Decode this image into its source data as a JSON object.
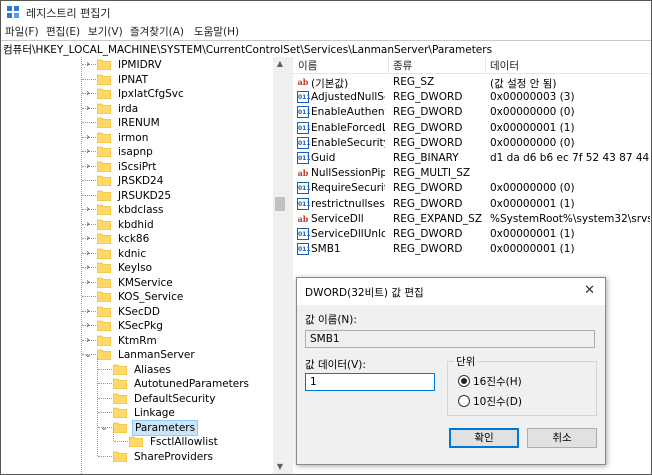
{
  "window": {
    "title": "레지스트리 편집기"
  },
  "menu": [
    "파일(F)",
    "편집(E)",
    "보기(V)",
    "즐겨찾기(A)",
    "도움말(H)"
  ],
  "address": "컴퓨터\\HKEY_LOCAL_MACHINE\\SYSTEM\\CurrentControlSet\\Services\\LanmanServer\\Parameters",
  "tree": {
    "items": [
      {
        "label": "IPMIDRV",
        "chevron": "›"
      },
      {
        "label": "IPNAT",
        "chevron": ""
      },
      {
        "label": "IpxlatCfgSvc",
        "chevron": "›"
      },
      {
        "label": "irda",
        "chevron": "›"
      },
      {
        "label": "IRENUM",
        "chevron": ""
      },
      {
        "label": "irmon",
        "chevron": "›"
      },
      {
        "label": "isapnp",
        "chevron": "›"
      },
      {
        "label": "iScsiPrt",
        "chevron": "›"
      },
      {
        "label": "JRSKD24",
        "chevron": ""
      },
      {
        "label": "JRSUKD25",
        "chevron": ""
      },
      {
        "label": "kbdclass",
        "chevron": "›"
      },
      {
        "label": "kbdhid",
        "chevron": "›"
      },
      {
        "label": "kck86",
        "chevron": "›"
      },
      {
        "label": "kdnic",
        "chevron": "›"
      },
      {
        "label": "KeyIso",
        "chevron": "›"
      },
      {
        "label": "KMService",
        "chevron": "›"
      },
      {
        "label": "KOS_Service",
        "chevron": ""
      },
      {
        "label": "KSecDD",
        "chevron": "›"
      },
      {
        "label": "KSecPkg",
        "chevron": "›"
      },
      {
        "label": "KtmRm",
        "chevron": "›"
      },
      {
        "label": "LanmanServer",
        "chevron": "⌄"
      }
    ],
    "children": [
      {
        "label": "Aliases",
        "chevron": ""
      },
      {
        "label": "AutotunedParameters",
        "chevron": ""
      },
      {
        "label": "DefaultSecurity",
        "chevron": ""
      },
      {
        "label": "Linkage",
        "chevron": ""
      },
      {
        "label": "Parameters",
        "chevron": "⌄",
        "selected": true
      },
      {
        "label": "FsctlAllowlist",
        "chevron": "",
        "level": 2
      },
      {
        "label": "ShareProviders",
        "chevron": ""
      }
    ]
  },
  "list": {
    "columns": [
      "이름",
      "종류",
      "데이터"
    ],
    "rows": [
      {
        "icon": "ab",
        "name": "(기본값)",
        "type": "REG_SZ",
        "data": "(값 설정 안 됨)"
      },
      {
        "icon": "bin",
        "name": "AdjustedNullSes...",
        "type": "REG_DWORD",
        "data": "0x00000003 (3)"
      },
      {
        "icon": "bin",
        "name": "EnableAuthentic...",
        "type": "REG_DWORD",
        "data": "0x00000000 (0)"
      },
      {
        "icon": "bin",
        "name": "EnableForcedLo...",
        "type": "REG_DWORD",
        "data": "0x00000001 (1)"
      },
      {
        "icon": "bin",
        "name": "EnableSecurityS...",
        "type": "REG_DWORD",
        "data": "0x00000000 (0)"
      },
      {
        "icon": "bin",
        "name": "Guid",
        "type": "REG_BINARY",
        "data": "d1 da d6 b6 ec 7f 52 43 87 44 e4 a4"
      },
      {
        "icon": "ab",
        "name": "NullSessionPipes",
        "type": "REG_MULTI_SZ",
        "data": ""
      },
      {
        "icon": "bin",
        "name": "RequireSecurity...",
        "type": "REG_DWORD",
        "data": "0x00000000 (0)"
      },
      {
        "icon": "bin",
        "name": "restrictnullsessa...",
        "type": "REG_DWORD",
        "data": "0x00000001 (1)"
      },
      {
        "icon": "ab",
        "name": "ServiceDll",
        "type": "REG_EXPAND_SZ",
        "data": "%SystemRoot%\\system32\\srvsvc.dll"
      },
      {
        "icon": "bin",
        "name": "ServiceDllUnloa...",
        "type": "REG_DWORD",
        "data": "0x00000001 (1)"
      },
      {
        "icon": "bin",
        "name": "SMB1",
        "type": "REG_DWORD",
        "data": "0x00000001 (1)"
      }
    ]
  },
  "dialog": {
    "title": "DWORD(32비트) 값 편집",
    "close_glyph": "✕",
    "name_label": "값 이름(N):",
    "name_value": "SMB1",
    "data_label": "값 데이터(V):",
    "data_value": "1",
    "base_label": "단위",
    "hex_label": "16진수(H)",
    "dec_label": "10진수(D)",
    "base_selected": "hex",
    "ok_label": "확인",
    "cancel_label": "취소"
  },
  "colors": {
    "selection": "#cce4f7",
    "accent": "#0078d7",
    "folder": "#ffd866"
  }
}
